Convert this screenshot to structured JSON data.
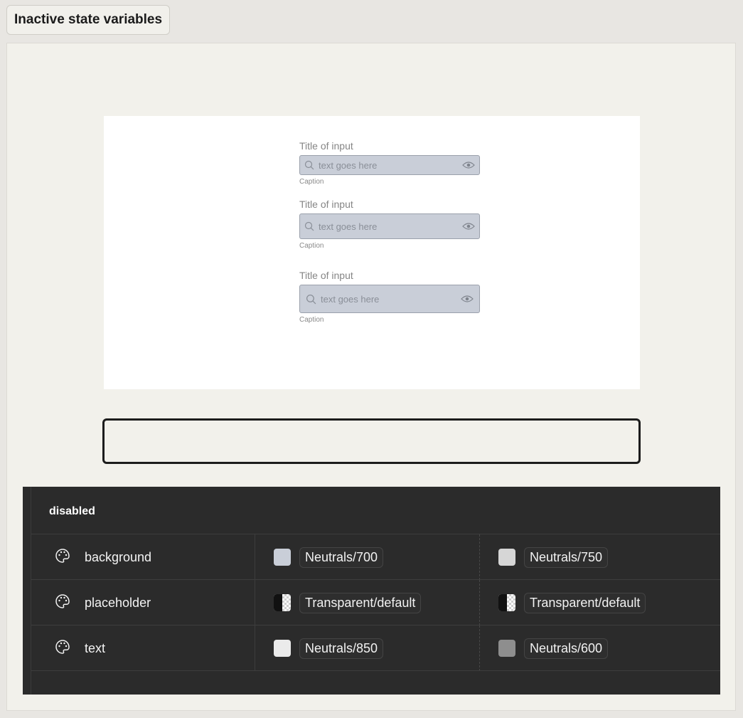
{
  "header": {
    "title": "Inactive state variables"
  },
  "preview": {
    "fields": [
      {
        "title": "Title of input",
        "placeholder": "text goes here",
        "caption": "Caption"
      },
      {
        "title": "Title of input",
        "placeholder": "text goes here",
        "caption": "Caption"
      },
      {
        "title": "Title of input",
        "placeholder": "text goes here",
        "caption": "Caption"
      }
    ],
    "input_bg": "#c9ced8"
  },
  "variables": {
    "group": "disabled",
    "rows": [
      {
        "icon": "palette-icon",
        "name": "background",
        "mode1": {
          "token": "Neutrals/700",
          "swatch": "#c9ced8"
        },
        "mode2": {
          "token": "Neutrals/750",
          "swatch": "#d6d6d6"
        }
      },
      {
        "icon": "palette-icon",
        "name": "placeholder",
        "mode1": {
          "token": "Transparent/default",
          "swatch": "transparent"
        },
        "mode2": {
          "token": "Transparent/default",
          "swatch": "transparent"
        }
      },
      {
        "icon": "palette-icon",
        "name": "text",
        "mode1": {
          "token": "Neutrals/850",
          "swatch": "#ebebeb"
        },
        "mode2": {
          "token": "Neutrals/600",
          "swatch": "#8e8e8e"
        }
      }
    ]
  }
}
